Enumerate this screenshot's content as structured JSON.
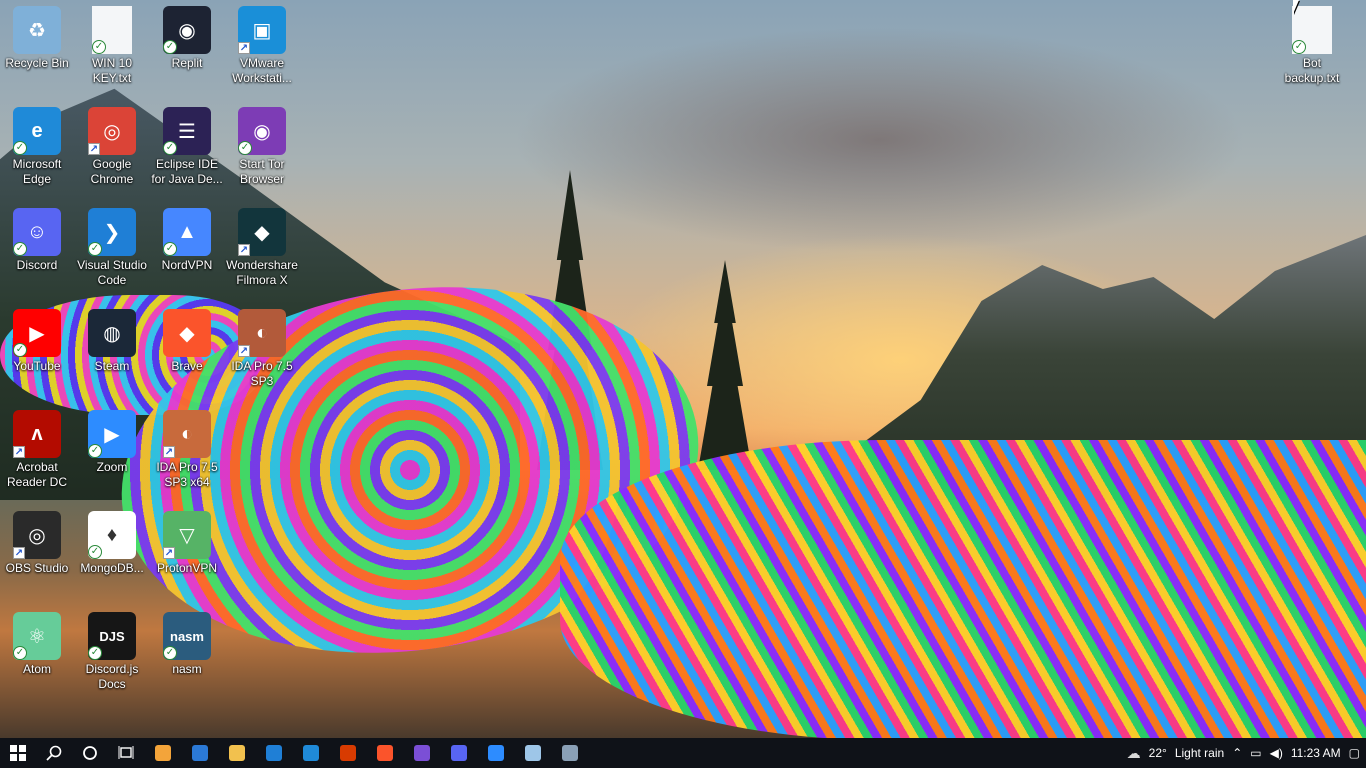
{
  "desktop": {
    "icons": [
      {
        "id": "recycle-bin",
        "label": "Recycle Bin",
        "icon": "recycle-bin-icon",
        "color": "#7fb0d8",
        "glyph": "♻",
        "badge": "none"
      },
      {
        "id": "win10-key",
        "label": "WIN 10\nKEY.txt",
        "icon": "text-file-icon",
        "color": "#f4f6f8",
        "glyph": "",
        "badge": "check"
      },
      {
        "id": "replit",
        "label": "Replit",
        "icon": "replit-icon",
        "color": "#1d2333",
        "glyph": "◉",
        "badge": "check"
      },
      {
        "id": "vmware",
        "label": "VMware\nWorkstati...",
        "icon": "vmware-icon",
        "color": "#1a8fd8",
        "glyph": "▣",
        "badge": "shortcut"
      },
      {
        "id": "edge",
        "label": "Microsoft\nEdge",
        "icon": "edge-icon",
        "color": "#1f8ad8",
        "glyph": "e",
        "badge": "check"
      },
      {
        "id": "chrome",
        "label": "Google\nChrome",
        "icon": "chrome-icon",
        "color": "#db4437",
        "glyph": "◎",
        "badge": "shortcut"
      },
      {
        "id": "eclipse",
        "label": "Eclipse IDE\nfor Java De...",
        "icon": "eclipse-icon",
        "color": "#2c2255",
        "glyph": "☰",
        "badge": "check"
      },
      {
        "id": "tor",
        "label": "Start Tor\nBrowser",
        "icon": "tor-icon",
        "color": "#7d3cb5",
        "glyph": "◉",
        "badge": "check"
      },
      {
        "id": "discord",
        "label": "Discord",
        "icon": "discord-icon",
        "color": "#5865f2",
        "glyph": "☺",
        "badge": "check"
      },
      {
        "id": "vscode",
        "label": "Visual Studio\nCode",
        "icon": "vscode-icon",
        "color": "#1f7fd6",
        "glyph": "❯",
        "badge": "check"
      },
      {
        "id": "nordvpn",
        "label": "NordVPN",
        "icon": "nordvpn-icon",
        "color": "#4687ff",
        "glyph": "▲",
        "badge": "check"
      },
      {
        "id": "filmora",
        "label": "Wondershare\nFilmora X",
        "icon": "filmora-icon",
        "color": "#12353c",
        "glyph": "◆",
        "badge": "shortcut"
      },
      {
        "id": "youtube",
        "label": "YouTube",
        "icon": "youtube-icon",
        "color": "#ff0000",
        "glyph": "▶",
        "badge": "check"
      },
      {
        "id": "steam",
        "label": "Steam",
        "icon": "steam-icon",
        "color": "#1b2838",
        "glyph": "◍",
        "badge": "none"
      },
      {
        "id": "brave",
        "label": "Brave",
        "icon": "brave-icon",
        "color": "#fb542b",
        "glyph": "◆",
        "badge": "none"
      },
      {
        "id": "ida-pro-sp3",
        "label": "IDA Pro 7.5\nSP3",
        "icon": "ida-pro-icon",
        "color": "#b25a3a",
        "glyph": "◐",
        "badge": "shortcut"
      },
      {
        "id": "acrobat",
        "label": "Acrobat\nReader DC",
        "icon": "acrobat-icon",
        "color": "#b30b00",
        "glyph": "ʌ",
        "badge": "shortcut"
      },
      {
        "id": "zoom",
        "label": "Zoom",
        "icon": "zoom-icon",
        "color": "#2d8cff",
        "glyph": "▶",
        "badge": "check"
      },
      {
        "id": "ida-pro-x64",
        "label": "IDA Pro 7.5\nSP3 x64",
        "icon": "ida-pro-x64-icon",
        "color": "#c86a3c",
        "glyph": "◐",
        "badge": "shortcut"
      },
      {
        "id": "obs",
        "label": "OBS Studio",
        "icon": "obs-icon",
        "color": "#2a2a2a",
        "glyph": "◎",
        "badge": "shortcut"
      },
      {
        "id": "mongodb",
        "label": "MongoDB...",
        "icon": "mongodb-icon",
        "color": "#ffffff",
        "glyph": "♦",
        "badge": "check"
      },
      {
        "id": "protonvpn",
        "label": "ProtonVPN",
        "icon": "protonvpn-icon",
        "color": "#56b366",
        "glyph": "▽",
        "badge": "shortcut"
      },
      {
        "id": "atom",
        "label": "Atom",
        "icon": "atom-icon",
        "color": "#66cc99",
        "glyph": "⚛",
        "badge": "check"
      },
      {
        "id": "discordjs",
        "label": "Discord.js\nDocs",
        "icon": "discordjs-icon",
        "color": "#161616",
        "glyph": "DJS",
        "badge": "check"
      },
      {
        "id": "nasm",
        "label": "nasm",
        "icon": "nasm-icon",
        "color": "#2b5c7e",
        "glyph": "nasm",
        "badge": "check"
      },
      {
        "id": "bot-backup",
        "label": "Bot\nbackup.txt",
        "icon": "text-file-icon",
        "color": "#f4f6f8",
        "glyph": "",
        "badge": "check"
      }
    ]
  },
  "taskbar": {
    "start_icon": "windows-start-icon",
    "search_icon": "search-icon",
    "cortana_icon": "cortana-icon",
    "taskview_icon": "task-view-icon",
    "apps": [
      {
        "id": "store",
        "icon": "microsoft-store-icon",
        "color": "#f3a43a"
      },
      {
        "id": "mail",
        "icon": "mail-icon",
        "color": "#2b79d6"
      },
      {
        "id": "explorer",
        "icon": "file-explorer-icon",
        "color": "#f2c14e"
      },
      {
        "id": "vscode",
        "icon": "vscode-icon",
        "color": "#1f7fd6"
      },
      {
        "id": "edge",
        "icon": "edge-icon",
        "color": "#1f8ad8"
      },
      {
        "id": "office",
        "icon": "office-icon",
        "color": "#d83b01"
      },
      {
        "id": "brave",
        "icon": "brave-icon",
        "color": "#fb542b"
      },
      {
        "id": "visualstudio",
        "icon": "visual-studio-icon",
        "color": "#7b4fd6"
      },
      {
        "id": "discord",
        "icon": "discord-icon",
        "color": "#5865f2"
      },
      {
        "id": "zoom",
        "icon": "zoom-icon",
        "color": "#2d8cff"
      },
      {
        "id": "notepad",
        "icon": "notepad-icon",
        "color": "#9ec6e8"
      },
      {
        "id": "rdp",
        "icon": "remote-desktop-icon",
        "color": "#8aa0b6"
      }
    ],
    "tray": {
      "weather_temp": "22°",
      "weather_text": "Light rain",
      "time": "11:23 AM"
    }
  }
}
